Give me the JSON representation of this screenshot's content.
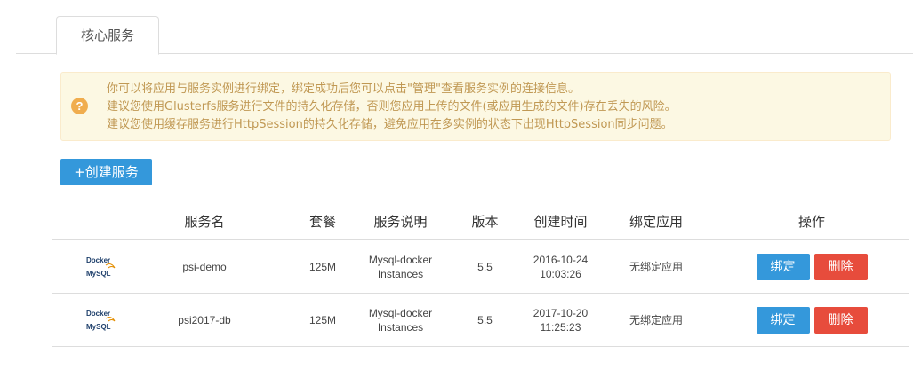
{
  "tabs": [
    {
      "label": "核心服务"
    }
  ],
  "alert": {
    "lines": [
      "你可以将应用与服务实例进行绑定，绑定成功后您可以点击\"管理\"查看服务实例的连接信息。",
      "建议您使用Glusterfs服务进行文件的持久化存储，否则您应用上传的文件(或应用生成的文件)存在丢失的风险。",
      "建议您使用缓存服务进行HttpSession的持久化存储，避免应用在多实例的状态下出现HttpSession同步问题。"
    ]
  },
  "create_button": "+创建服务",
  "table": {
    "headers": {
      "name": "服务名",
      "plan": "套餐",
      "desc": "服务说明",
      "version": "版本",
      "created": "创建时间",
      "bound": "绑定应用",
      "ops": "操作"
    },
    "rows": [
      {
        "logo_top": "Docker",
        "logo_bottom": "MySQL",
        "name": "psi-demo",
        "plan": "125M",
        "desc1": "Mysql-docker",
        "desc2": "Instances",
        "version": "5.5",
        "date": "2016-10-24",
        "time": "10:03:26",
        "bound": "无绑定应用",
        "bind_label": "绑定",
        "delete_label": "删除"
      },
      {
        "logo_top": "Docker",
        "logo_bottom": "MySQL",
        "name": "psi2017-db",
        "plan": "125M",
        "desc1": "Mysql-docker",
        "desc2": "Instances",
        "version": "5.5",
        "date": "2017-10-20",
        "time": "11:25:23",
        "bound": "无绑定应用",
        "bind_label": "绑定",
        "delete_label": "删除"
      }
    ]
  },
  "colors": {
    "primary": "#3498db",
    "danger": "#e74c3c",
    "alert_bg": "#fcf8e3",
    "alert_text": "#c09853",
    "alert_icon": "#f0ad4e"
  },
  "icons": {
    "alert": "question-circle-icon",
    "service_logo": "docker-mysql-logo"
  }
}
